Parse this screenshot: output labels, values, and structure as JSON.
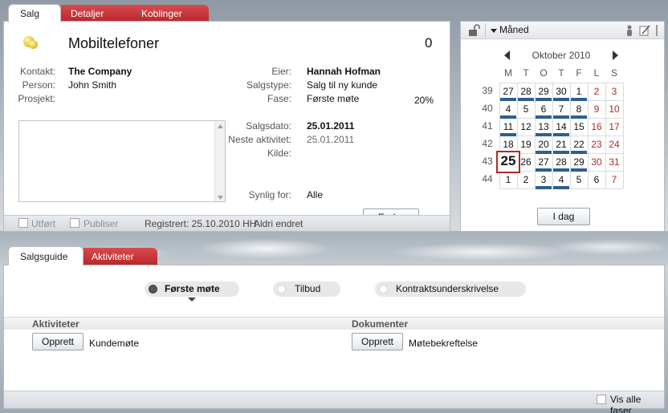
{
  "top_tabs": [
    {
      "label": "Salg"
    },
    {
      "label": "Detaljer"
    },
    {
      "label": "Koblinger"
    }
  ],
  "sale": {
    "title": "Mobiltelefoner",
    "count": "0",
    "contact_label": "Kontakt:",
    "contact_value": "The Company",
    "person_label": "Person:",
    "person_value": "John Smith",
    "project_label": "Prosjekt:",
    "project_value": "",
    "owner_label": "Eier:",
    "owner_value": "Hannah Hofman",
    "saletype_label": "Salgstype:",
    "saletype_value": "Salg til ny kunde",
    "stage_label": "Fase:",
    "stage_value": "Første møte",
    "probability": "20%",
    "saledate_label": "Salgsdato:",
    "saledate_value": "25.01.2011",
    "next_activity_label": "Neste aktivitet:",
    "next_activity_value": "25.01.2011",
    "source_label": "Kilde:",
    "source_value": "",
    "visible_for_label": "Synlig for:",
    "visible_for_value": "Alle",
    "edit_button": "Endre",
    "footer": {
      "done_label": "Utført",
      "publish_label": "Publiser",
      "registered": "Registrert: 25.10.2010 HH",
      "changed": "Aldri endret"
    }
  },
  "calendar": {
    "view_label": "Måned",
    "month_label": "Oktober 2010",
    "today_button": "I dag",
    "day_headers": [
      "M",
      "T",
      "O",
      "T",
      "F",
      "L",
      "S"
    ],
    "weeks": [
      {
        "week": "39",
        "days": [
          {
            "d": "27",
            "bar": true
          },
          {
            "d": "28",
            "bar": true
          },
          {
            "d": "29",
            "bar": true
          },
          {
            "d": "30",
            "bar": true
          },
          {
            "d": "1",
            "bar": true
          },
          {
            "d": "2",
            "bar": false
          },
          {
            "d": "3",
            "bar": false
          }
        ]
      },
      {
        "week": "40",
        "days": [
          {
            "d": "4",
            "bar": true
          },
          {
            "d": "5",
            "bar": false
          },
          {
            "d": "6",
            "bar": true
          },
          {
            "d": "7",
            "bar": true
          },
          {
            "d": "8",
            "bar": true
          },
          {
            "d": "9",
            "bar": false
          },
          {
            "d": "10",
            "bar": false
          }
        ]
      },
      {
        "week": "41",
        "days": [
          {
            "d": "11",
            "bar": true
          },
          {
            "d": "12",
            "bar": false
          },
          {
            "d": "13",
            "bar": true
          },
          {
            "d": "14",
            "bar": true
          },
          {
            "d": "15",
            "bar": false
          },
          {
            "d": "16",
            "bar": false
          },
          {
            "d": "17",
            "bar": false
          }
        ]
      },
      {
        "week": "42",
        "days": [
          {
            "d": "18",
            "bar": true
          },
          {
            "d": "19",
            "bar": false
          },
          {
            "d": "20",
            "bar": true
          },
          {
            "d": "21",
            "bar": true
          },
          {
            "d": "22",
            "bar": true
          },
          {
            "d": "23",
            "bar": false
          },
          {
            "d": "24",
            "bar": false
          }
        ]
      },
      {
        "week": "43",
        "days": [
          {
            "d": "25",
            "bar": true
          },
          {
            "d": "26",
            "bar": false
          },
          {
            "d": "27",
            "bar": true
          },
          {
            "d": "28",
            "bar": true
          },
          {
            "d": "29",
            "bar": true
          },
          {
            "d": "30",
            "bar": false
          },
          {
            "d": "31",
            "bar": false
          }
        ]
      },
      {
        "week": "44",
        "days": [
          {
            "d": "1",
            "bar": false
          },
          {
            "d": "2",
            "bar": false
          },
          {
            "d": "3",
            "bar": true
          },
          {
            "d": "4",
            "bar": true
          },
          {
            "d": "5",
            "bar": false
          },
          {
            "d": "6",
            "bar": false
          },
          {
            "d": "7",
            "bar": false
          }
        ]
      }
    ],
    "today": "25",
    "colors": {
      "activity_bar": "#2d5f8e",
      "weekend": "#b02a2a",
      "today_border": "#b02a2a"
    }
  },
  "bottom_tabs": [
    {
      "label": "Salgsguide"
    },
    {
      "label": "Aktiviteter"
    }
  ],
  "guide": {
    "phases": [
      {
        "label": "Første møte",
        "active": true
      },
      {
        "label": "Tilbud",
        "active": false
      },
      {
        "label": "Kontraktsunderskrivelse",
        "active": false
      }
    ],
    "activities_header": "Aktiviteter",
    "documents_header": "Dokumenter",
    "create_button": "Opprett",
    "activity_item": "Kundemøte",
    "document_item": "Møtebekreftelse",
    "show_all_phases": "Vis alle faser"
  },
  "icons": {
    "sale": "coins-icon",
    "lock": "unlock-icon",
    "dropdown": "triangle-down-icon",
    "prev": "chevron-left-icon",
    "next": "chevron-right-icon"
  },
  "colors": {
    "tab_red": "#c3302f",
    "panel_bg": "#ffffff"
  }
}
